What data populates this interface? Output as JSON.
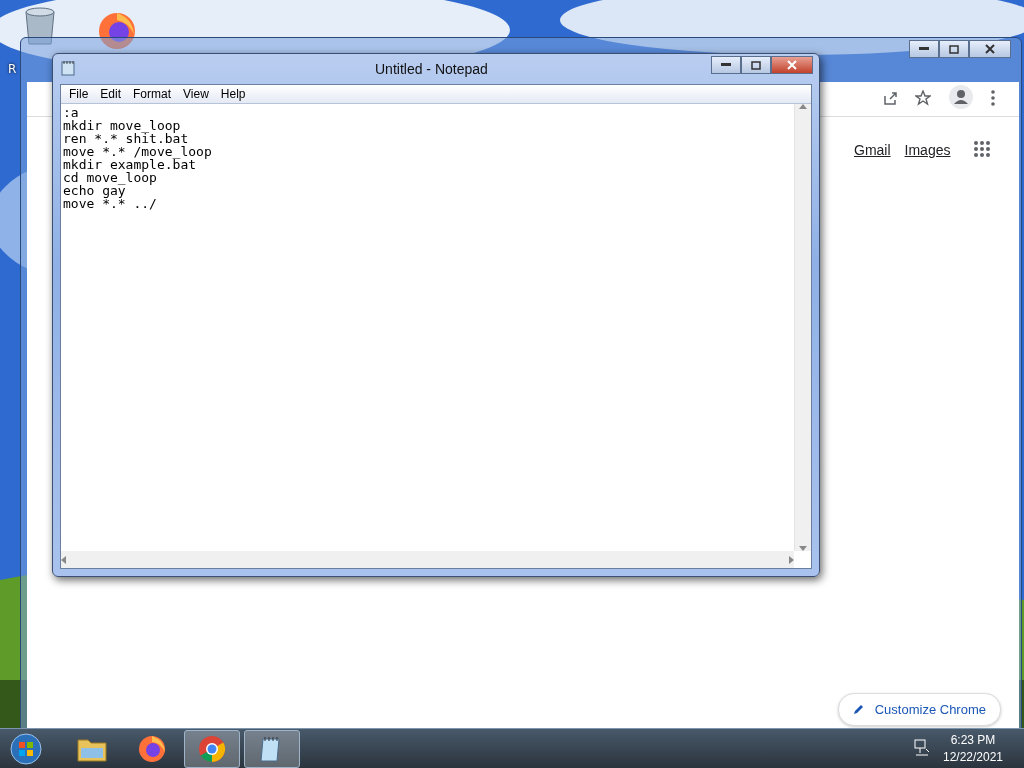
{
  "desktop": {
    "icons": [
      {
        "kind": "recycle",
        "label": "R"
      },
      {
        "kind": "firefox"
      }
    ]
  },
  "browser": {
    "links": [
      "Gmail",
      "Images"
    ],
    "customize_button": "Customize Chrome"
  },
  "notepad": {
    "title": "Untitled - Notepad",
    "menu": [
      "File",
      "Edit",
      "Format",
      "View",
      "Help"
    ],
    "lines": [
      ":a",
      "mkdir move_loop",
      "ren *.* shit.bat",
      "move *.* /move_loop",
      "mkdir example.bat",
      "cd move_loop",
      "echo gay",
      "move *.* ../"
    ]
  },
  "taskbar": {
    "items": [
      {
        "kind": "explorer",
        "selected": false
      },
      {
        "kind": "firefox",
        "selected": false
      },
      {
        "kind": "chrome",
        "selected": true
      },
      {
        "kind": "notepad",
        "selected": true
      }
    ],
    "time": "6:23 PM",
    "date": "12/22/2021"
  }
}
